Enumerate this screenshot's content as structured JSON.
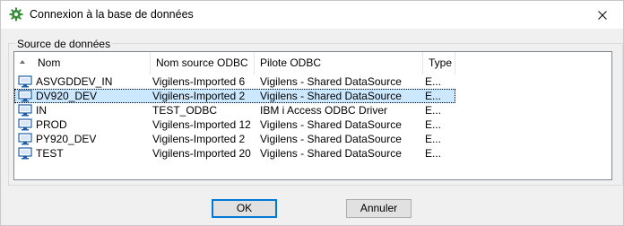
{
  "window": {
    "title": "Connexion à la base de données",
    "icon": "gear-icon",
    "close_icon": "close-icon"
  },
  "group": {
    "label": "Source de données"
  },
  "table": {
    "sort_indicator": "sort-ascending-icon",
    "columns": [
      {
        "label": "Nom"
      },
      {
        "label": "Nom source ODBC"
      },
      {
        "label": "Pilote ODBC"
      },
      {
        "label": "Type"
      }
    ],
    "rows": [
      {
        "name": "ASVGDDEV_IN",
        "odbc_source": "Vigilens-Imported 6",
        "driver": "Vigilens - Shared DataSource",
        "type": "E...",
        "selected": false
      },
      {
        "name": "DV920_DEV",
        "odbc_source": "Vigilens-Imported 2",
        "driver": "Vigilens - Shared DataSource",
        "type": "E...",
        "selected": true
      },
      {
        "name": "IN",
        "odbc_source": "TEST_ODBC",
        "driver": "IBM i Access ODBC Driver",
        "type": "E...",
        "selected": false
      },
      {
        "name": "PROD",
        "odbc_source": "Vigilens-Imported 12",
        "driver": "Vigilens - Shared DataSource",
        "type": "E...",
        "selected": false
      },
      {
        "name": "PY920_DEV",
        "odbc_source": "Vigilens-Imported 2",
        "driver": "Vigilens - Shared DataSource",
        "type": "E...",
        "selected": false
      },
      {
        "name": "TEST",
        "odbc_source": "Vigilens-Imported 20",
        "driver": "Vigilens - Shared DataSource",
        "type": "E...",
        "selected": false
      }
    ]
  },
  "buttons": {
    "ok_label": "OK",
    "cancel_label": "Annuler"
  },
  "colors": {
    "selection": "#cce8ff",
    "default_button_border": "#0078d7",
    "gear": "#3c8f3c",
    "monitor": "#1f5fa8"
  }
}
